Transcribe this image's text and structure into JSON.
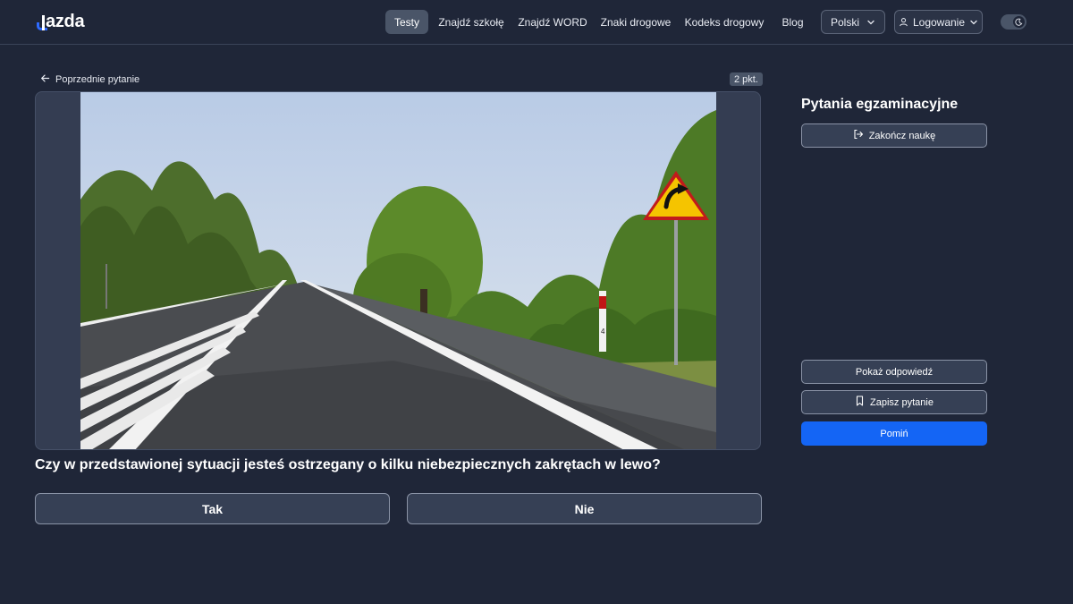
{
  "header": {
    "logo": "jazda",
    "nav": [
      {
        "label": "Testy",
        "active": true
      },
      {
        "label": "Znajdź szkołę",
        "active": false
      },
      {
        "label": "Znajdź WORD",
        "active": false
      },
      {
        "label": "Znaki drogowe",
        "active": false
      },
      {
        "label": "Kodeks drogowy",
        "active": false
      },
      {
        "label": "Blog",
        "active": false
      }
    ],
    "language": {
      "label": "Polski",
      "icon": "chevron-down-icon"
    },
    "login": {
      "label": "Logowanie",
      "icon": "user-icon"
    },
    "theme_toggle": {
      "icon": "moon-icon",
      "state": "dark"
    }
  },
  "question": {
    "previous_label": "Poprzednie pytanie",
    "points": "2 pkt.",
    "text": "Czy w przedstawionej sytuacji jesteś ostrzegany o kilku niebezpiecznych zakrętach w lewo?",
    "answers": [
      "Tak",
      "Nie"
    ],
    "image": {
      "sign_plate_digit": "4"
    }
  },
  "sidebar": {
    "title": "Pytania egzaminacyjne",
    "end_label": "Zakończ naukę",
    "show_answer_label": "Pokaż odpowiedź",
    "save_label": "Zapisz pytanie",
    "skip_label": "Pomiń"
  },
  "colors": {
    "background": "#1f2638",
    "primary": "#1465f5",
    "button": "#364055"
  }
}
